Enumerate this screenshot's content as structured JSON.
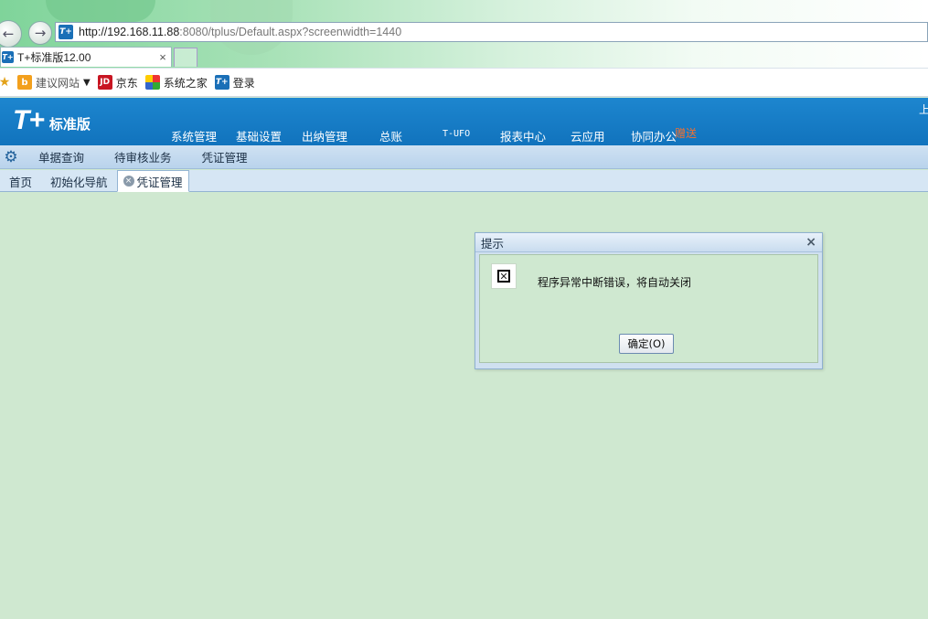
{
  "browser": {
    "url_host": "http://192.168.11.88",
    "url_rest": ":8080/tplus/Default.aspx?screenwidth=1440",
    "tab_title": "T+标准版12.00",
    "tab_close": "×",
    "favicon_text": "T+",
    "favorites": [
      {
        "label": "建议网站",
        "icon": "bing-icon",
        "icon_text": "b"
      },
      {
        "label": "京东",
        "icon": "jd-icon",
        "icon_text": "JD"
      },
      {
        "label": "系统之家",
        "icon": "xitongzhijia-icon",
        "icon_text": ""
      },
      {
        "label": "登录",
        "icon": "tplus-icon",
        "icon_text": "T+"
      }
    ]
  },
  "app": {
    "logo_mark": "T+",
    "logo_text": "标准版",
    "header_right": "上",
    "gift_badge": "赠送",
    "main_menu": [
      "系统管理",
      "基础设置",
      "出纳管理",
      "总账",
      "T-UFO",
      "报表中心",
      "云应用",
      "协同办公"
    ],
    "sub_menu": [
      "单据查询",
      "待审核业务",
      "凭证管理"
    ],
    "tabs": [
      "首页",
      "初始化导航",
      "凭证管理"
    ]
  },
  "dialog": {
    "title": "提示",
    "message": "程序异常中断错误，将自动关闭",
    "ok_label": "确定(O)",
    "close": "×",
    "icon": "error-x-icon"
  },
  "colors": {
    "header_blue": "#1173bd",
    "content_bg": "#cfe8d0",
    "gift_orange": "#f07030"
  }
}
